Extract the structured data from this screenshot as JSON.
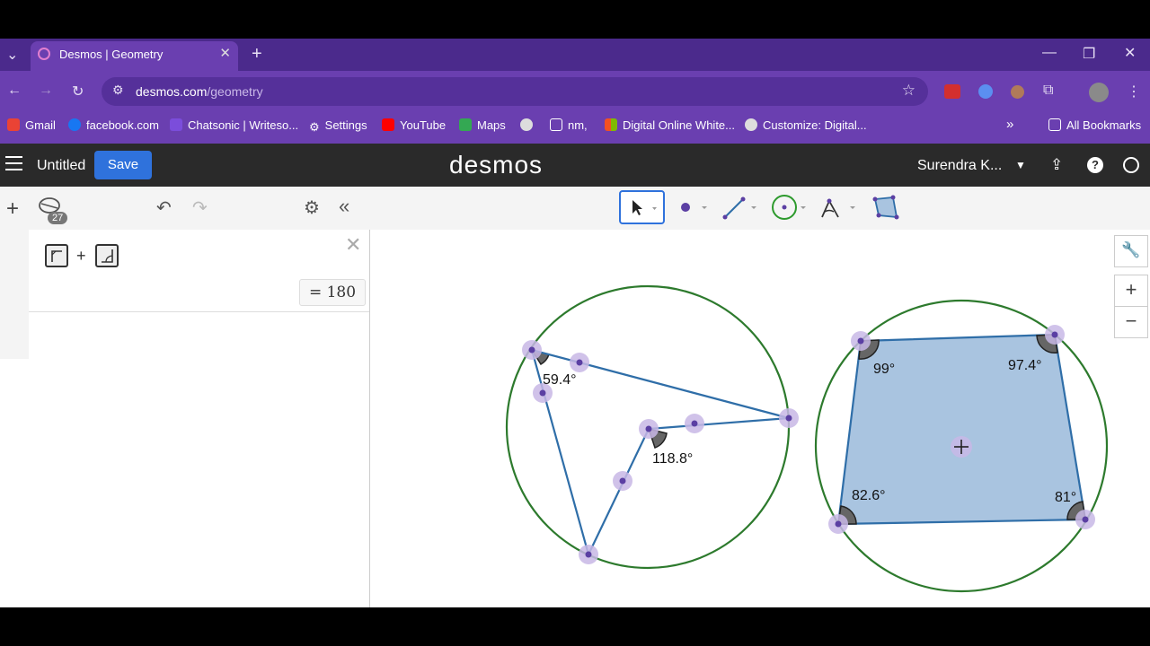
{
  "browser": {
    "tab_title": "Desmos | Geometry",
    "url_host": "desmos.com",
    "url_path": "/geometry",
    "bookmarks": [
      "Gmail",
      "facebook.com",
      "Chatsonic | Writeso...",
      "Settings",
      "YouTube",
      "Maps",
      "nm,",
      "Digital Online White...",
      "Customize: Digital..."
    ],
    "all_bookmarks": "All Bookmarks",
    "more": "»"
  },
  "header": {
    "title": "Untitled",
    "save_label": "Save",
    "logo": "desmos",
    "user": "Surendra K..."
  },
  "panel": {
    "history_count": "27",
    "expression_plus": "+",
    "result": "= 180"
  },
  "canvas": {
    "angle_labels": {
      "a1": "59.4°",
      "a2": "118.8°",
      "q1": "99°",
      "q2": "97.4°",
      "q3": "82.6°",
      "q4": "81°"
    }
  },
  "colors": {
    "circle": "#2d7a2d",
    "segment": "#2f6ea8",
    "point": "#5b3fa3",
    "fill": "#a9c4e0",
    "accent": "#2f72dc",
    "browser": "#6a3fb0"
  }
}
